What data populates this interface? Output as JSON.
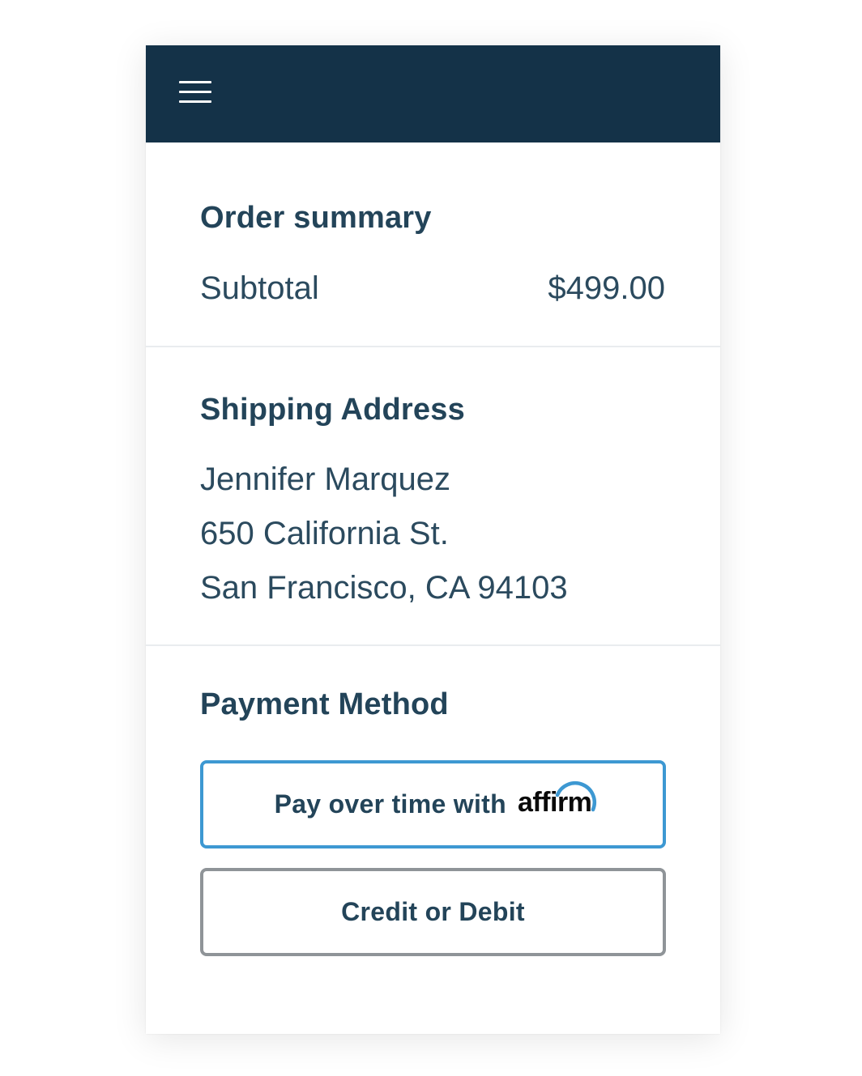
{
  "header": {
    "menu_icon": "hamburger-menu-icon",
    "background_color": "#143248"
  },
  "order_summary": {
    "title": "Order summary",
    "subtotal_label": "Subtotal",
    "subtotal_value": "$499.00"
  },
  "shipping": {
    "title": "Shipping Address",
    "name": "Jennifer Marquez",
    "line1": "650 California St.",
    "line2": "San Francisco, CA 94103"
  },
  "payment": {
    "title": "Payment Method",
    "affirm_button_label": "Pay over time with",
    "affirm_logo_text": "affirm",
    "affirm_border_color": "#3d98d2",
    "card_button_label": "Credit or Debit",
    "card_border_color": "#8f9498"
  },
  "colors": {
    "heading": "#234459",
    "accent_blue": "#3d98d2"
  }
}
